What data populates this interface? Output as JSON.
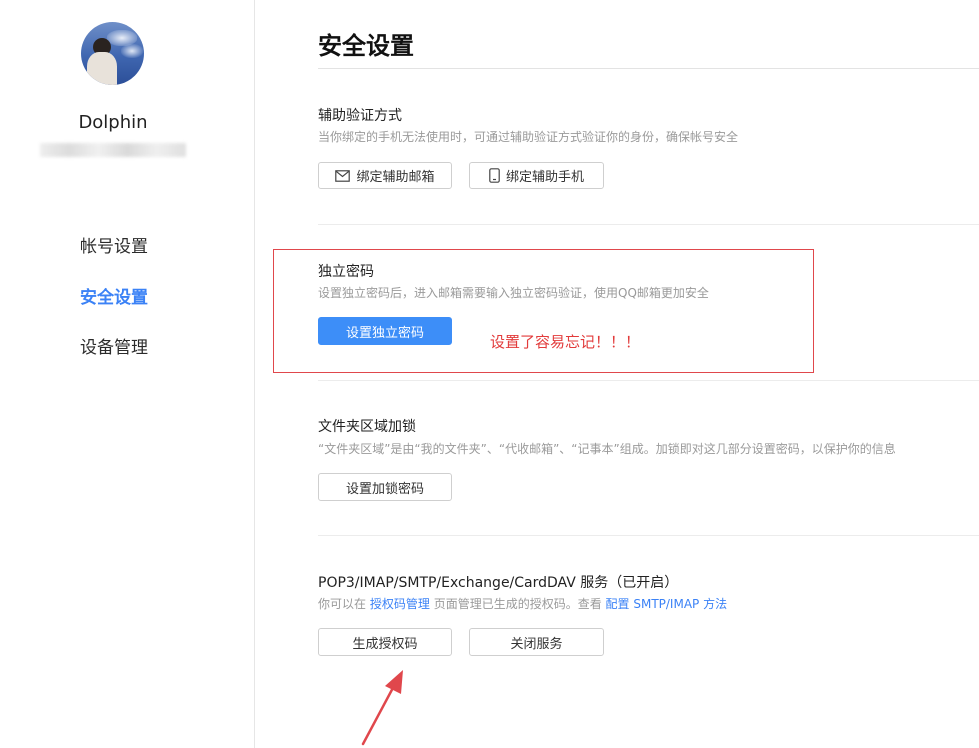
{
  "sidebar": {
    "username": "Dolphin",
    "nav": [
      {
        "label": "帐号设置",
        "active": false
      },
      {
        "label": "安全设置",
        "active": true
      },
      {
        "label": "设备管理",
        "active": false
      }
    ]
  },
  "main": {
    "title": "安全设置",
    "sections": {
      "auxiliary": {
        "title": "辅助验证方式",
        "desc": "当你绑定的手机无法使用时，可通过辅助验证方式验证你的身份，确保帐号安全",
        "buttons": {
          "bind_email": "绑定辅助邮箱",
          "bind_phone": "绑定辅助手机"
        }
      },
      "independent_password": {
        "title": "独立密码",
        "desc": "设置独立密码后，进入邮箱需要输入独立密码验证，使用QQ邮箱更加安全",
        "button": "设置独立密码"
      },
      "folder_lock": {
        "title": "文件夹区域加锁",
        "desc": "“文件夹区域”是由“我的文件夹”、“代收邮箱”、“记事本”组成。加锁即对这几部分设置密码，以保护你的信息",
        "button": "设置加锁密码"
      },
      "service": {
        "title": "POP3/IMAP/SMTP/Exchange/CardDAV 服务（已开启）",
        "desc_prefix": "你可以在",
        "desc_link1": "授权码管理",
        "desc_middle": "页面管理已生成的授权码。查看",
        "desc_link2": "配置 SMTP/IMAP 方法",
        "buttons": {
          "generate": "生成授权码",
          "close": "关闭服务"
        }
      }
    }
  },
  "annotation": {
    "text": "设置了容易忘记！！！",
    "color": "#e23b3b"
  },
  "colors": {
    "accent": "#3d8ef8",
    "active_nav": "#3b82f6",
    "annotation_red": "#e0474c"
  },
  "icons": {
    "email": "envelope-icon",
    "phone": "mobile-phone-icon",
    "arrow": "red-arrow-annotation"
  }
}
